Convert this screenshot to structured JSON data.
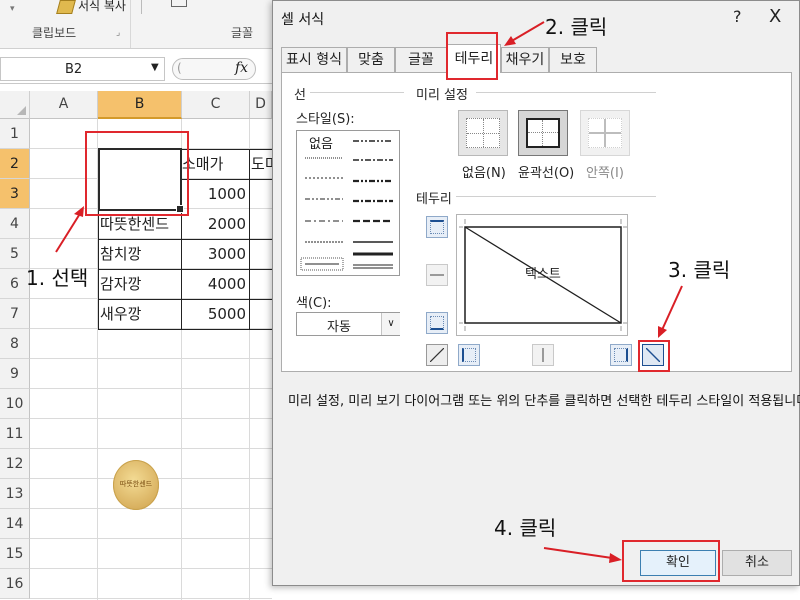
{
  "excel": {
    "ribbon": {
      "format_painter": "서식 복사",
      "group_clipboard": "클립보드",
      "group_font": "글꼴"
    },
    "name_box": "B2",
    "fx_label": "fx",
    "columns": [
      "A",
      "B",
      "C",
      "D"
    ],
    "rows": [
      "1",
      "2",
      "3",
      "4",
      "5",
      "6",
      "7",
      "8",
      "9",
      "10",
      "11",
      "12",
      "13",
      "14",
      "15",
      "16"
    ],
    "cells": {
      "c2": "소매가",
      "d2": "도미",
      "b4": "따뜻한센드",
      "b5": "참치깡",
      "b6": "감자깡",
      "b7": "새우깡",
      "c3": "1000",
      "c4": "2000",
      "c5": "3000",
      "c6": "4000",
      "c7": "5000"
    },
    "badge_text": "따뜻한센드"
  },
  "annotations": {
    "step1": "1. 선택",
    "step2": "2. 클릭",
    "step3": "3. 클릭",
    "step4": "4. 클릭",
    "highlight_color": "#e0282e"
  },
  "dialog": {
    "title": "셀 서식",
    "help": "?",
    "close": "X",
    "tabs": [
      {
        "label": "표시 형식",
        "active": false
      },
      {
        "label": "맞춤",
        "active": false
      },
      {
        "label": "글꼴",
        "active": false
      },
      {
        "label": "테두리",
        "active": true
      },
      {
        "label": "채우기",
        "active": false
      },
      {
        "label": "보호",
        "active": false
      }
    ],
    "line_section": "선",
    "style_label": "스타일(S):",
    "style_none": "없음",
    "color_label": "색(C):",
    "color_value": "자동",
    "presets_section": "미리 설정",
    "presets": [
      {
        "label": "없음(N)"
      },
      {
        "label": "윤곽선(O)"
      },
      {
        "label": "안쪽(I)"
      }
    ],
    "border_section": "테두리",
    "preview_text": "텍스트",
    "info_text": "미리 설정, 미리 보기 다이어그램 또는 위의 단추를 클릭하면 선택한 테두리 스타일이 적용됩니다.",
    "ok_label": "확인",
    "cancel_label": "취소"
  }
}
